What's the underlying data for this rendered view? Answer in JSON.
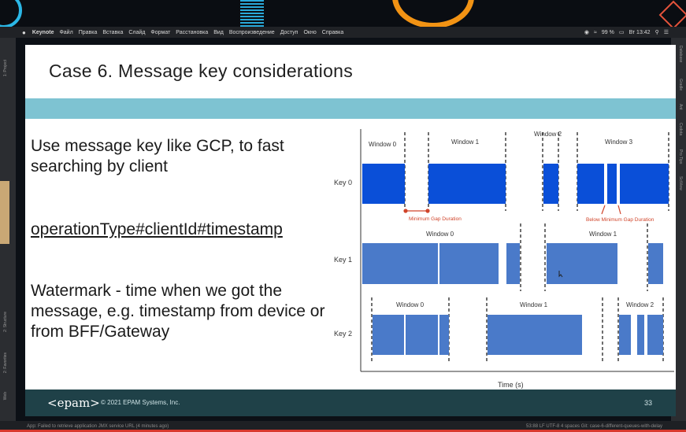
{
  "menubar": {
    "apple": "",
    "items": [
      "Keynote",
      "Файл",
      "Правка",
      "Вставка",
      "Слайд",
      "Формат",
      "Расстановка",
      "Вид",
      "Воспроизведение",
      "Доступ",
      "Окно",
      "Справка"
    ],
    "battery": "99 %",
    "clock": "Вт 13:42"
  },
  "sidepanels": {
    "left": [
      "1: Project",
      "2: Structure",
      "2: Favorites",
      "Web"
    ],
    "right": [
      "Database",
      "Gradle",
      "Ant",
      "Codota",
      "Pro Tips",
      "SciView"
    ]
  },
  "slide": {
    "title": "Case 6. Message key considerations",
    "bullet1": "Use message key like GCP, to fast searching by client",
    "key_format": "operationType#clientId#timestamp",
    "bullet3": "Watermark - time when we got the message, e.g. timestamp from device or from BFF/Gateway",
    "footer": {
      "logo": "<epam>",
      "copyright": "© 2021 EPAM Systems, Inc.",
      "page_number": "33"
    }
  },
  "status": {
    "message": "App: Failed to retrieve application JMX service URL (4 minutes ago)",
    "right": "53:88  LF  UTF-8  4 spaces  Git: case-6-different-queues-with-delay"
  },
  "colors": {
    "dark_blue": "#0a4fd8",
    "mid_blue": "#4a7ac9",
    "annotation_red": "#d0442a",
    "band": "#7ec3d2",
    "footer": "#1f4148"
  },
  "chart_data": {
    "type": "timeline",
    "xlabel": "Time (s)",
    "rows": [
      {
        "name": "Key 0",
        "windows": [
          "Window 0",
          "Window 1",
          "Window 2",
          "Window 3"
        ],
        "annotations": [
          "Minimum Gap Duration",
          "Below Minimum Gap Duration"
        ]
      },
      {
        "name": "Key 1",
        "windows": [
          "Window 0",
          "Window 1"
        ]
      },
      {
        "name": "Key 2",
        "windows": [
          "Window 0",
          "Window 1",
          "Window 2"
        ]
      }
    ]
  }
}
